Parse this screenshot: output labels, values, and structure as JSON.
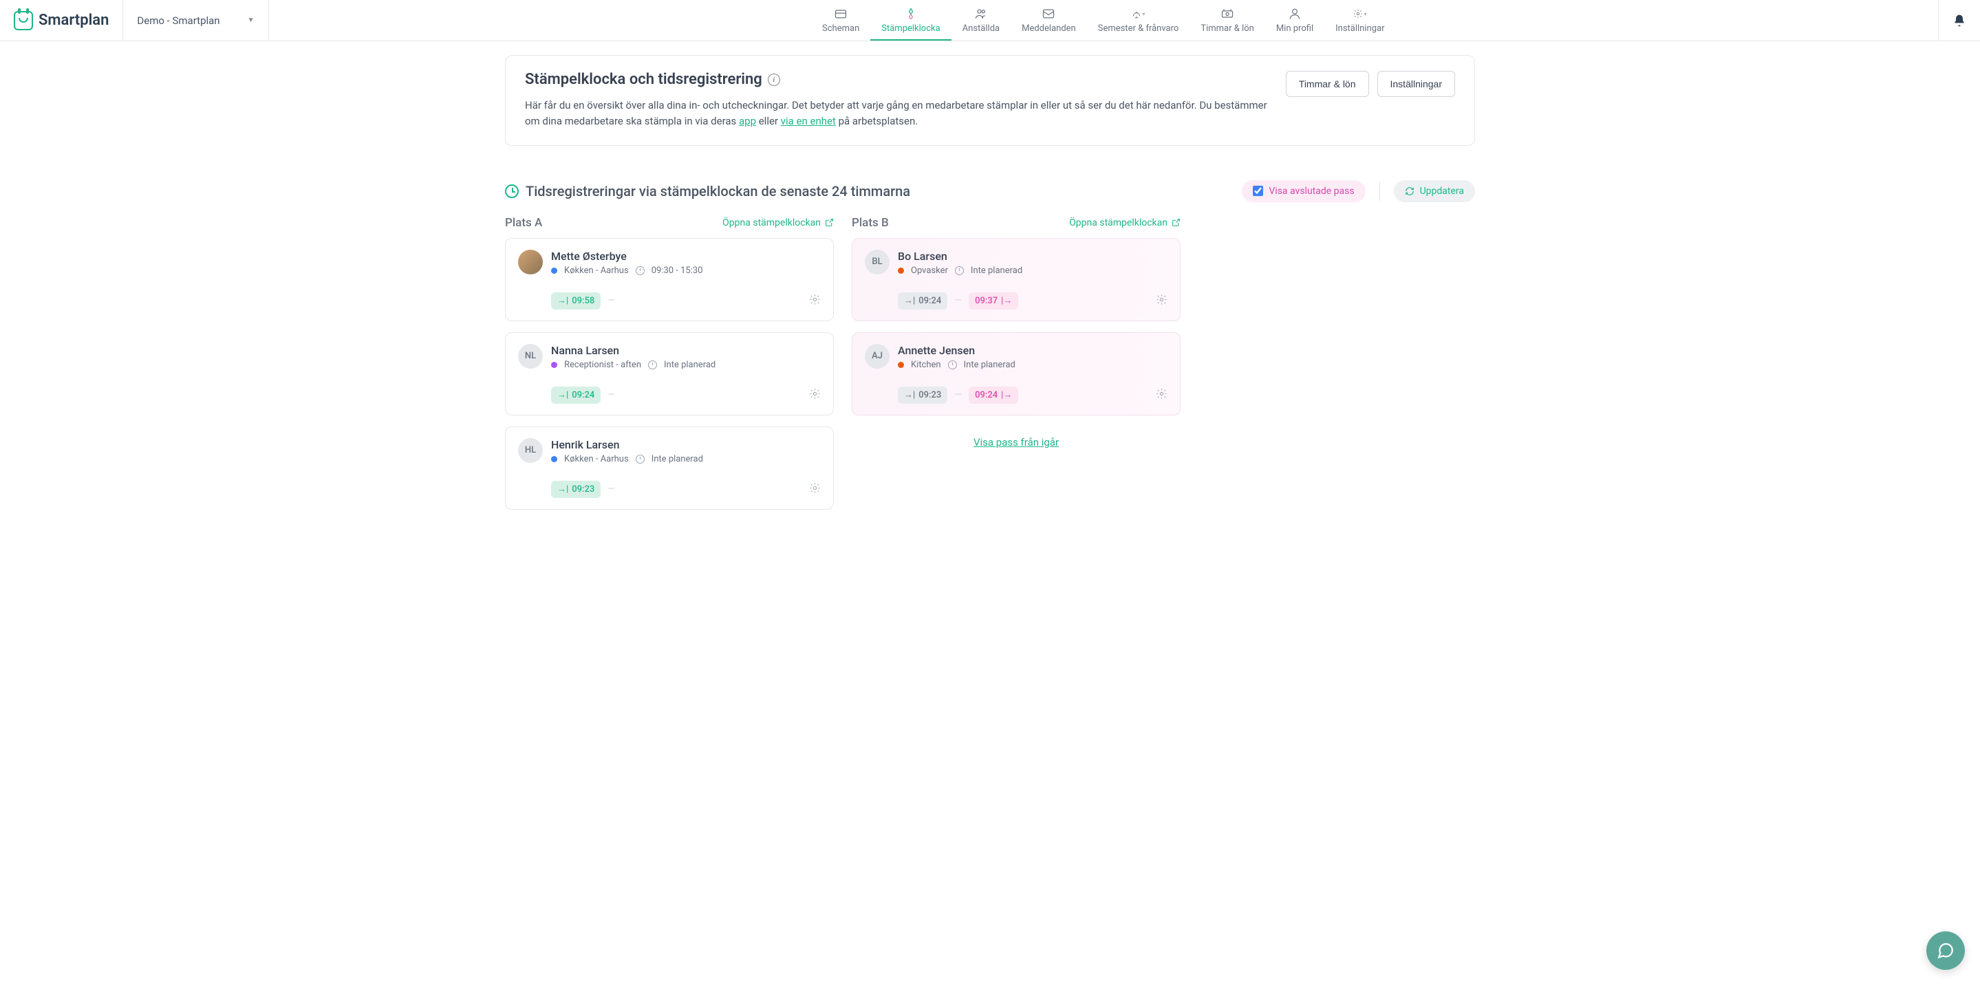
{
  "brand": "Smartplan",
  "workspace": "Demo - Smartplan",
  "nav": [
    {
      "label": "Scheman"
    },
    {
      "label": "Stämpelklocka",
      "active": true
    },
    {
      "label": "Anställda"
    },
    {
      "label": "Meddelanden"
    },
    {
      "label": "Semester & frånvaro"
    },
    {
      "label": "Timmar & lön"
    },
    {
      "label": "Min profil"
    },
    {
      "label": "Inställningar"
    }
  ],
  "intro": {
    "title": "Stämpelklocka och tidsregistrering",
    "text_pre": "Här får du en översikt över alla dina in- och utcheckningar. Det betyder att varje gång en medarbetare stämplar in eller ut så ser du det här nedanför. Du bestämmer om dina medarbetare ska stämpla in via deras ",
    "link_app": "app",
    "text_mid": " eller ",
    "link_device": "via en enhet",
    "text_post": " på arbetsplatsen.",
    "btn_hours": "Timmar & lön",
    "btn_settings": "Inställningar"
  },
  "section": {
    "title": "Tidsregistreringar via stämpelklockan de senaste 24 timmarna",
    "show_completed": "Visa avslutade pass",
    "show_completed_checked": true,
    "refresh": "Uppdatera"
  },
  "open_punchclock": "Öppna stämpelklockan",
  "locations": [
    {
      "name": "Plats A",
      "cards": [
        {
          "name": "Mette Østerbye",
          "initials": "",
          "avatar_img": true,
          "dot": "blue",
          "role": "Køkken - Aarhus",
          "sched": "09:30 - 15:30",
          "in": "09:58",
          "in_style": "in",
          "out": "",
          "done": false
        },
        {
          "name": "Nanna Larsen",
          "initials": "NL",
          "avatar_img": false,
          "dot": "purple",
          "role": "Receptionist - aften",
          "sched": "Inte planerad",
          "in": "09:24",
          "in_style": "in",
          "out": "",
          "done": false
        },
        {
          "name": "Henrik Larsen",
          "initials": "HL",
          "avatar_img": false,
          "dot": "blue",
          "role": "Køkken - Aarhus",
          "sched": "Inte planerad",
          "in": "09:23",
          "in_style": "in",
          "out": "",
          "done": false
        }
      ]
    },
    {
      "name": "Plats B",
      "cards": [
        {
          "name": "Bo Larsen",
          "initials": "BL",
          "avatar_img": false,
          "dot": "orange",
          "role": "Opvasker",
          "sched": "Inte planerad",
          "in": "09:24",
          "in_style": "in-grey",
          "out": "09:37",
          "done": true
        },
        {
          "name": "Annette Jensen",
          "initials": "AJ",
          "avatar_img": false,
          "dot": "orange",
          "role": "Kitchen",
          "sched": "Inte planerad",
          "in": "09:23",
          "in_style": "in-grey",
          "out": "09:24",
          "done": true
        }
      ],
      "yesterday_link": "Visa pass från igår"
    }
  ]
}
